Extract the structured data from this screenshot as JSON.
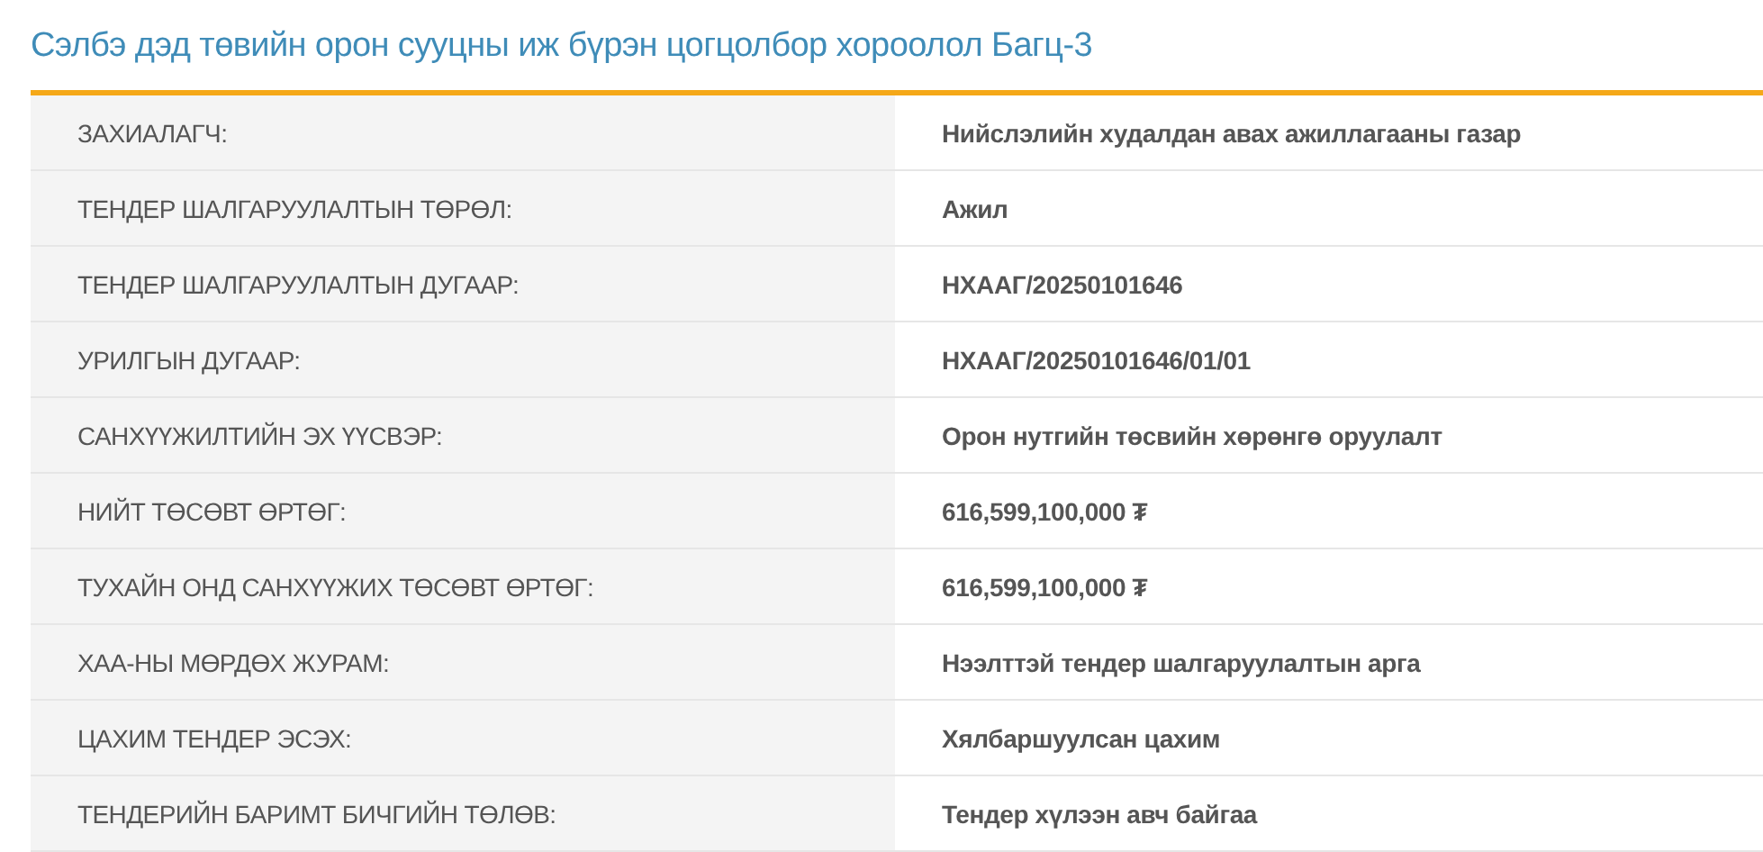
{
  "title": "Сэлбэ дэд төвийн орон сууцны иж бүрэн цогцолбор хороолол Багц-3",
  "rows": [
    {
      "label": "ЗАХИАЛАГЧ:",
      "value": "Нийслэлийн худалдан авах ажиллагааны газар"
    },
    {
      "label": "ТЕНДЕР ШАЛГАРУУЛАЛТЫН ТӨРӨЛ:",
      "value": "Ажил"
    },
    {
      "label": "ТЕНДЕР ШАЛГАРУУЛАЛТЫН ДУГААР:",
      "value": "НХААГ/20250101646"
    },
    {
      "label": "УРИЛГЫН ДУГААР:",
      "value": "НХААГ/20250101646/01/01"
    },
    {
      "label": "САНХҮҮЖИЛТИЙН ЭХ ҮҮСВЭР:",
      "value": "Орон нутгийн төсвийн хөрөнгө оруулалт"
    },
    {
      "label": "НИЙТ ТӨСӨВТ ӨРТӨГ:",
      "value": "616,599,100,000 ₮"
    },
    {
      "label": "ТУХАЙН ОНД САНХҮҮЖИХ ТӨСӨВТ ӨРТӨГ:",
      "value": "616,599,100,000 ₮"
    },
    {
      "label": "ХАА-НЫ МӨРДӨХ ЖУРАМ:",
      "value": "Нээлттэй тендер шалгаруулалтын арга"
    },
    {
      "label": "ЦАХИМ ТЕНДЕР ЭСЭХ:",
      "value": "Хялбаршуулсан цахим"
    },
    {
      "label": "ТЕНДЕРИЙН БАРИМТ БИЧГИЙН ТӨЛӨВ:",
      "value": "Тендер хүлээн авч байгаа"
    }
  ]
}
